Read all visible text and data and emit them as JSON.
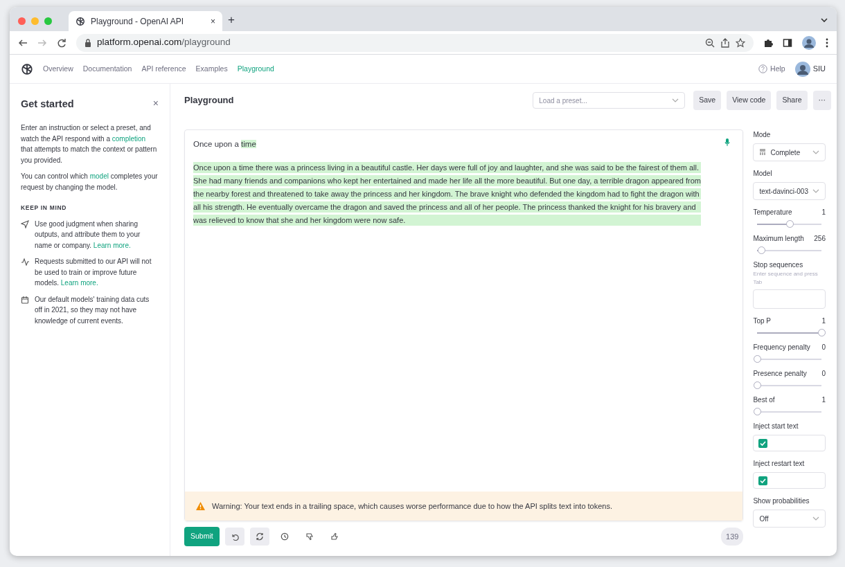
{
  "browser": {
    "tab_title": "Playground - OpenAI API",
    "tab_close": "×",
    "new_tab": "+",
    "url_host": "platform.openai.com",
    "url_path": "/playground"
  },
  "nav": {
    "items": [
      {
        "label": "Overview",
        "selected": false
      },
      {
        "label": "Documentation",
        "selected": false
      },
      {
        "label": "API reference",
        "selected": false
      },
      {
        "label": "Examples",
        "selected": false
      },
      {
        "label": "Playground",
        "selected": true
      }
    ],
    "help": "Help",
    "user": "SIU"
  },
  "sidebar": {
    "title": "Get started",
    "close": "×",
    "paragraphs": [
      [
        {
          "kind": "text",
          "text": "Enter an instruction or select a preset, and watch the API respond with a "
        },
        {
          "kind": "link",
          "text": "completion"
        },
        {
          "kind": "text",
          "text": " that attempts to match the context or pattern you provided."
        }
      ],
      [
        {
          "kind": "text",
          "text": "You can control which "
        },
        {
          "kind": "link",
          "text": "model"
        },
        {
          "kind": "text",
          "text": " completes your request by changing the model."
        }
      ]
    ],
    "keep_heading": "KEEP IN MIND",
    "tips": [
      {
        "parts": [
          {
            "kind": "text",
            "text": "Use good judgment when sharing outputs, and attribute them to your name or company. "
          },
          {
            "kind": "link",
            "text": "Learn more."
          }
        ]
      },
      {
        "parts": [
          {
            "kind": "text",
            "text": "Requests submitted to our API will not be used to train or improve future models. "
          },
          {
            "kind": "link",
            "text": "Learn more."
          }
        ]
      },
      {
        "parts": [
          {
            "kind": "text",
            "text": "Our default models' training data cuts off in 2021, so they may not have knowledge of current events."
          }
        ]
      }
    ]
  },
  "playground": {
    "title": "Playground",
    "preset_placeholder": "Load a preset...",
    "buttons": [
      "Save",
      "View code",
      "Share",
      "···"
    ]
  },
  "editor": {
    "prompt": [
      {
        "text": "Once upon a ",
        "highlighted": false
      },
      {
        "text": "time",
        "highlighted": true
      }
    ],
    "completion": "Once upon a time there was a princess living in a beautiful castle. Her days were full of joy and laughter, and she was said to be the fairest of them all. She had many friends and companions who kept her entertained and made her life all the more beautiful. But one day, a terrible dragon appeared from the nearby forest and threatened to take away the princess and her kingdom. The brave knight who defended the kingdom had to fight the dragon with all his strength. He eventually overcame the dragon and saved the princess and all of her people. The princess thanked the knight for his bravery and was relieved to know that she and her kingdom were now safe.",
    "warning": "Warning: Your text ends in a trailing space, which causes worse performance due to how the API splits text into tokens.",
    "submit": "Submit",
    "token_count": "139"
  },
  "settings": [
    {
      "kind": "select",
      "label": "Mode",
      "value": "Complete"
    },
    {
      "kind": "select",
      "label": "Model",
      "value": "text-davinci-003"
    },
    {
      "kind": "slider",
      "label": "Temperature",
      "reading": "1",
      "level": 0.5
    },
    {
      "kind": "slider",
      "label": "Maximum length",
      "reading": "256",
      "level": 0.06
    },
    {
      "kind": "input",
      "label": "Stop sequences",
      "hint": "Enter sequence and press Tab"
    },
    {
      "kind": "slider",
      "label": "Top P",
      "reading": "1",
      "level": 1
    },
    {
      "kind": "slider",
      "label": "Frequency penalty",
      "reading": "0",
      "level": 0
    },
    {
      "kind": "slider",
      "label": "Presence penalty",
      "reading": "0",
      "level": 0
    },
    {
      "kind": "slider",
      "label": "Best of",
      "reading": "1",
      "level": 0
    },
    {
      "kind": "checkbox",
      "label": "Inject start text",
      "checked": true
    },
    {
      "kind": "checkbox",
      "label": "Inject restart text",
      "checked": true
    },
    {
      "kind": "select",
      "label": "Show probabilities",
      "value": "Off"
    }
  ]
}
